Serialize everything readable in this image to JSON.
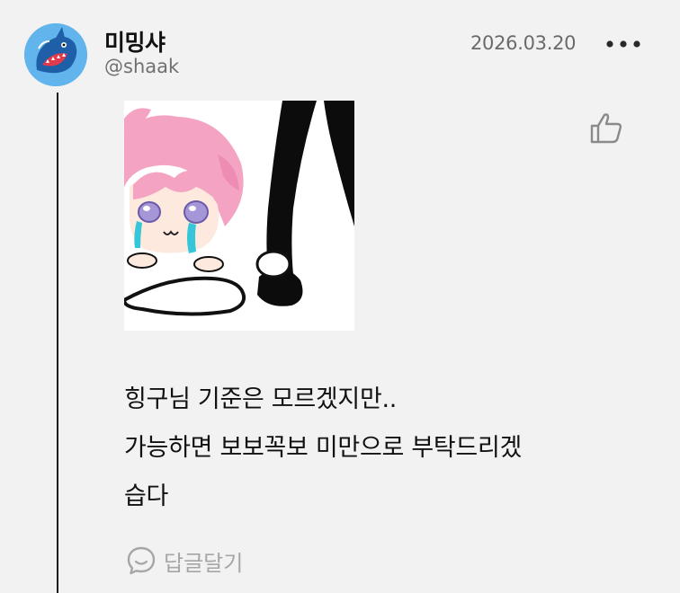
{
  "post": {
    "author": {
      "display_name": "미밍샤",
      "handle": "@shaak",
      "avatar_icon": "shark-avatar"
    },
    "date": "2026.03.20",
    "more_icon": "more-dots-icon",
    "like_icon": "thumbs-up-icon",
    "image": {
      "description_icon": "crying-character-sticker"
    },
    "body_lines": [
      "힝구님 기준은 모르겠지만..",
      "가능하면 보보꼭보 미만으로 부탁드리겠",
      "습다"
    ],
    "reply": {
      "icon": "speech-bubble-icon",
      "label": "답글달기"
    }
  },
  "colors": {
    "background": "#f2f2f3",
    "avatar_bg": "#62b4ec",
    "muted_text": "#707070",
    "reply_text": "#a6a6a6"
  }
}
